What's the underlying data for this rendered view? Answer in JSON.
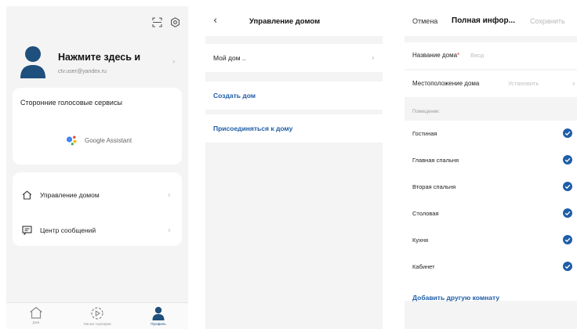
{
  "profile": {
    "name": "Нажмите здесь и",
    "email": "ctv.user@yandex.ru",
    "voice_services_title": "Сторонние голосовые сервисы",
    "google_assistant": "Google Assistant",
    "menu": [
      {
        "label": "Управление домом",
        "icon": "house-icon"
      },
      {
        "label": "Центр сообщений",
        "icon": "message-icon"
      }
    ],
    "nav": [
      {
        "label": "Дом",
        "icon": "home-icon"
      },
      {
        "label": "Умные сценарии",
        "icon": "scenes-icon"
      },
      {
        "label": "Профиль",
        "icon": "profile-icon",
        "active": true
      }
    ],
    "colors": {
      "accent": "#1f5ea8",
      "avatar": "#1e4f7d"
    }
  },
  "home_management": {
    "title": "Управление домом",
    "my_home": "Мой дом ..",
    "create_home": "Создать дом",
    "join_home": "Присоединяться к дому"
  },
  "home_info": {
    "cancel": "Отмена",
    "title": "Полная инфор...",
    "save": "Сохранить",
    "name_label": "Название дома",
    "required_mark": "*",
    "name_placeholder": "Ввод",
    "location_label": "Местоположение дома",
    "location_placeholder": "Установить",
    "rooms_section": "Помещение:",
    "rooms": [
      {
        "name": "Гостиная",
        "checked": true
      },
      {
        "name": "Главная спальня",
        "checked": true
      },
      {
        "name": "Вторая спальня",
        "checked": true
      },
      {
        "name": "Столовая",
        "checked": true
      },
      {
        "name": "Кухня",
        "checked": true
      },
      {
        "name": "Кабинет",
        "checked": true
      }
    ],
    "add_room": "Добавить другую комнату",
    "colors": {
      "check": "#1f5ea8"
    }
  }
}
